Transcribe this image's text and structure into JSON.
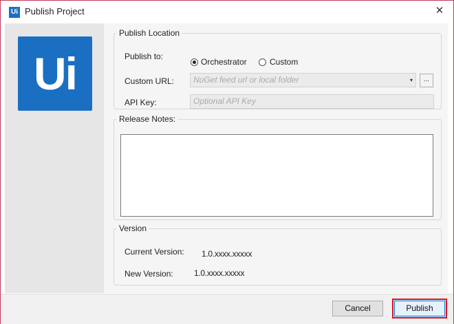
{
  "window": {
    "title": "Publish Project",
    "app_icon_text": "Ui",
    "close_glyph": "✕",
    "logo_text": "Ui",
    "accent_color": "#1a6fc2"
  },
  "publish_location": {
    "legend": "Publish Location",
    "publish_to_label": "Publish to:",
    "options": [
      {
        "label": "Orchestrator",
        "selected": true
      },
      {
        "label": "Custom",
        "selected": false
      }
    ],
    "custom_url_label": "Custom URL:",
    "custom_url_placeholder": "NuGet feed url or local folder",
    "custom_url_value": "",
    "dropdown_glyph": "▾",
    "browse_label": "...",
    "api_key_label": "API Key:",
    "api_key_placeholder": "Optional API Key",
    "api_key_value": ""
  },
  "release_notes": {
    "legend": "Release Notes:",
    "value": ""
  },
  "version": {
    "legend": "Version",
    "current_label": "Current Version:",
    "current_value": "1.0.xxxx.xxxxx",
    "new_label": "New Version:",
    "new_value": "1.0.xxxx.xxxxx"
  },
  "footer": {
    "cancel_label": "Cancel",
    "publish_label": "Publish",
    "highlight_color": "#e0101a"
  }
}
